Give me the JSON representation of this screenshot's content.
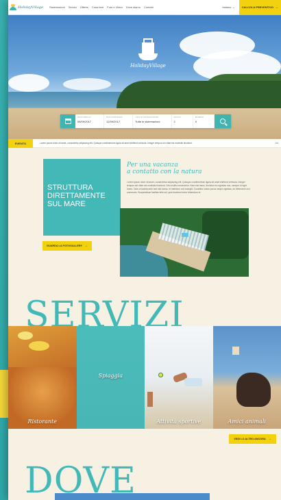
{
  "nav": {
    "logo_text": "HolidayVillage",
    "menu": [
      "Sistemazioni",
      "Servizi",
      "Offerte",
      "Cosa fare",
      "Foto e Video",
      "Dove siamo",
      "Contatti"
    ],
    "language": "Italiano",
    "quote_button": "CALCOLA PREVENTIVO"
  },
  "hero": {
    "brand": "HolidayVillage",
    "search": {
      "checkin_label": "DATA ARRIVO",
      "checkin_value": "06/09/2017",
      "checkout_label": "DATA PARTENZA",
      "checkout_value": "12/09/2017",
      "type_label": "TIPO DI SISTEMAZIONE",
      "type_value": "Tutte le sistemazioni",
      "adults_label": "ADULTI",
      "adults_value": "2",
      "children_label": "BAMBINI",
      "children_value": "0"
    }
  },
  "ticker": {
    "label": "EVENTO",
    "text": "Lorem ipsum dolor sit amet, consectetur adipiscing elit. Quisque condimentum ligula sit amet eleifend vehicula. Integer tempus dui vitae est molestie tincidunt.",
    "count": "1/4"
  },
  "intro": {
    "box_text": "STRUTTURA DIRETTAMENTE SUL MARE",
    "title_line1": "Per una vacanza",
    "title_line2": "a contatto con la natura",
    "body": "Lorem ipsum dolor sit amet, consectetur adipiscing elit. Quisque condimentum ligula sit amet eleifend vehicula. Integer tempus dui vitae est molestie tincidunt. Sed mollis consectetur. Nam nisi lacus, tincidunt eu egestas non, semper id eget lorem. Duis ut lacinia ante sed nisi luctus, et interdum orci suscipit. Curabitur luctus purus neque egestas, eu bibendum orci commodo. Suspendisse facilisis felis vel, quis tincidunt tortor bibendum et.",
    "gallery_button": "GUARDA LA FOTOGALLERY"
  },
  "services": {
    "title": "SERVIZI",
    "tiles": [
      {
        "caption": "Ristorante"
      },
      {
        "caption": "Spiaggia"
      },
      {
        "caption": "Attività sportive"
      },
      {
        "caption": "Amici animali"
      }
    ],
    "more_button": "VEDI LO ALTRO ANCORA"
  },
  "where": {
    "title": "DOVE"
  },
  "colors": {
    "teal": "#42b8b7",
    "yellow": "#f2d10f",
    "cream": "#f7f1e4"
  }
}
